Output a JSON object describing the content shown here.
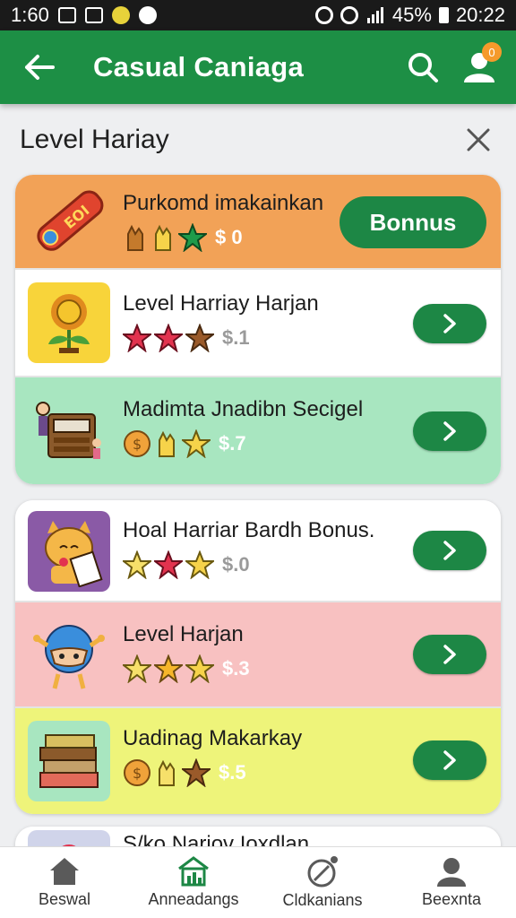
{
  "status_bar": {
    "time_left": "1:60",
    "battery": "45%",
    "time_right": "20:22"
  },
  "app_bar": {
    "title": "Casual Caniaga",
    "notification_count": "0"
  },
  "section": {
    "title": "Level Hariay"
  },
  "list_items": [
    {
      "title": "Purkomd imakainkan",
      "price": "$ 0",
      "action_label": "Bonnus",
      "bg": "#f2a257",
      "icons": [
        "hand-icon",
        "hand-icon",
        "star-icon"
      ]
    },
    {
      "title": "Level Harriay Harjan",
      "price": "$.1",
      "bg": "#ffffff",
      "icons": [
        "star-icon",
        "star-icon",
        "star-icon"
      ]
    },
    {
      "title": "Madimta Jnadibn Secigel",
      "price": "$.7",
      "bg": "#a8e6c0",
      "icons": [
        "coin-icon",
        "hand-icon",
        "star-icon"
      ]
    },
    {
      "title": "Hoal Harriar Bardh Bonus.",
      "price": "$.0",
      "bg": "#ffffff",
      "icons": [
        "star-icon",
        "star-icon",
        "star-icon"
      ]
    },
    {
      "title": "Level Harjan",
      "price": "$.3",
      "bg": "#f8c1c1",
      "icons": [
        "star-icon",
        "star-icon",
        "star-icon"
      ]
    },
    {
      "title": "Uadinag Makarkay",
      "price": "$.5",
      "bg": "#eef47a",
      "icons": [
        "coin-icon",
        "hand-icon",
        "star-icon"
      ]
    },
    {
      "title": "S/ko Nariov Ioxdlan"
    }
  ],
  "bottom_nav": [
    {
      "label": "Beswal",
      "icon": "home-icon"
    },
    {
      "label": "Anneadangs",
      "icon": "chart-icon"
    },
    {
      "label": "Cldkanians",
      "icon": "compass-icon"
    },
    {
      "label": "Beexnta",
      "icon": "profile-icon"
    }
  ],
  "colors": {
    "primary": "#1d8f45",
    "button": "#1d8745",
    "badge": "#f59a2b"
  }
}
